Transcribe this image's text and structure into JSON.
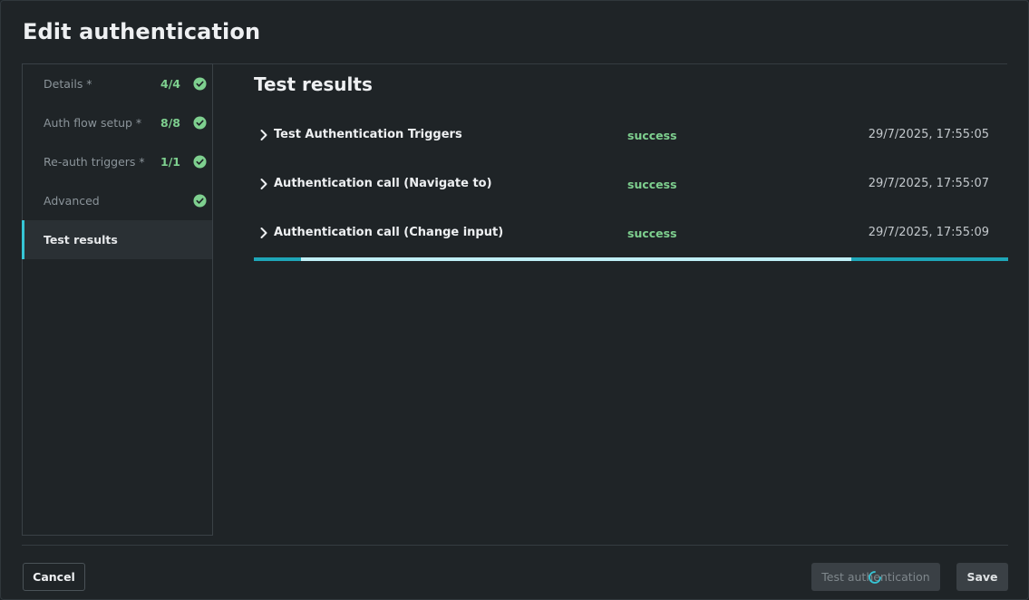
{
  "dialog": {
    "title": "Edit authentication"
  },
  "sidebar": {
    "items": [
      {
        "label": "Details *",
        "count": "4/4",
        "complete": true
      },
      {
        "label": "Auth flow setup *",
        "count": "8/8",
        "complete": true
      },
      {
        "label": "Re-auth triggers *",
        "count": "1/1",
        "complete": true
      },
      {
        "label": "Advanced",
        "count": "",
        "complete": true
      },
      {
        "label": "Test results",
        "count": "",
        "complete": false,
        "active": true
      }
    ]
  },
  "main": {
    "title": "Test results",
    "results": [
      {
        "name": "Test Authentication Triggers",
        "status": "success",
        "time": "29/7/2025, 17:55:05"
      },
      {
        "name": "Authentication call (Navigate to)",
        "status": "success",
        "time": "29/7/2025, 17:55:07"
      },
      {
        "name": "Authentication call (Change input)",
        "status": "success",
        "time": "29/7/2025, 17:55:09"
      }
    ],
    "progress_fraction": 0.73
  },
  "footer": {
    "cancel_label": "Cancel",
    "test_label": "Test authentication",
    "save_label": "Save"
  },
  "colors": {
    "accent": "#36c6d6",
    "success": "#7ed08f",
    "background": "#1f2427"
  },
  "icons": {
    "check": "check-circle-icon",
    "expand": "chevron-right-icon",
    "loading": "spinner-icon"
  }
}
